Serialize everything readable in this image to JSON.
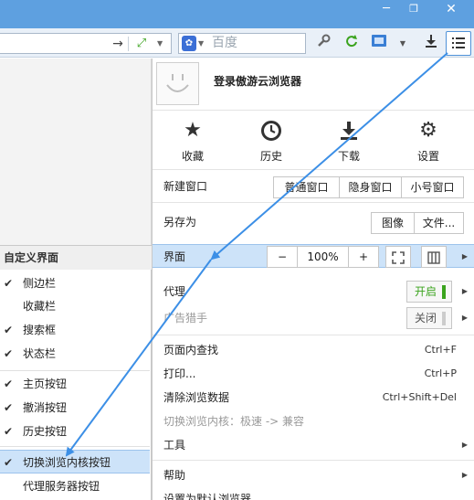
{
  "window": {
    "min_glyph": "─",
    "max_glyph": "❐",
    "close_glyph": "✕"
  },
  "toolbar": {
    "search_placeholder": "百度",
    "icons": [
      "go-arrow-icon",
      "cloud-speed-icon",
      "dropdown-icon",
      "baidu-paw-icon",
      "wrench-icon",
      "refresh-green-icon",
      "screenshot-icon",
      "dropdown-icon",
      "download-icon",
      "menu-list-icon"
    ]
  },
  "menu": {
    "login": "登录傲游云浏览器",
    "quick": [
      {
        "icon": "star-icon",
        "label": "收藏"
      },
      {
        "icon": "history-clock-icon",
        "label": "历史"
      },
      {
        "icon": "download-icon",
        "label": "下载"
      },
      {
        "icon": "gear-icon",
        "label": "设置"
      }
    ],
    "new_window": {
      "label": "新建窗口",
      "options": [
        "普通窗口",
        "隐身窗口",
        "小号窗口"
      ]
    },
    "save_as": {
      "label": "另存为",
      "options": [
        "图像",
        "文件..."
      ]
    },
    "interface": {
      "label": "界面",
      "zoom_minus": "−",
      "zoom_value": "100%",
      "zoom_plus": "+"
    },
    "proxy": {
      "label": "代理",
      "state": "开启",
      "state_color": "#3aa31d"
    },
    "adblock": {
      "label": "广告猎手",
      "state": "关闭",
      "state_color": "#bbbbbb"
    },
    "find": {
      "label": "页面内查找",
      "shortcut": "Ctrl+F"
    },
    "print": {
      "label": "打印...",
      "shortcut": "Ctrl+P"
    },
    "clear": {
      "label": "清除浏览数据",
      "shortcut": "Ctrl+Shift+Del"
    },
    "switch_core": {
      "label": "切换浏览内核：极速 -> 兼容"
    },
    "tools": {
      "label": "工具"
    },
    "help": {
      "label": "帮助"
    },
    "default_browser": {
      "label": "设置为默认浏览器"
    }
  },
  "submenu": {
    "title": "自定义界面",
    "items": [
      {
        "label": "侧边栏",
        "checked": true
      },
      {
        "label": "收藏栏",
        "checked": false
      },
      {
        "label": "搜索框",
        "checked": true
      },
      {
        "label": "状态栏",
        "checked": true
      },
      {
        "label": "主页按钮",
        "checked": true
      },
      {
        "label": "撤消按钮",
        "checked": true
      },
      {
        "label": "历史按钮",
        "checked": true
      },
      {
        "label": "切换浏览内核按钮",
        "checked": true
      },
      {
        "label": "代理服务器按钮",
        "checked": false
      }
    ]
  },
  "colors": {
    "accent": "#3c8fe6",
    "titlebar": "#5ea0e0",
    "highlight": "#cde3f9"
  }
}
